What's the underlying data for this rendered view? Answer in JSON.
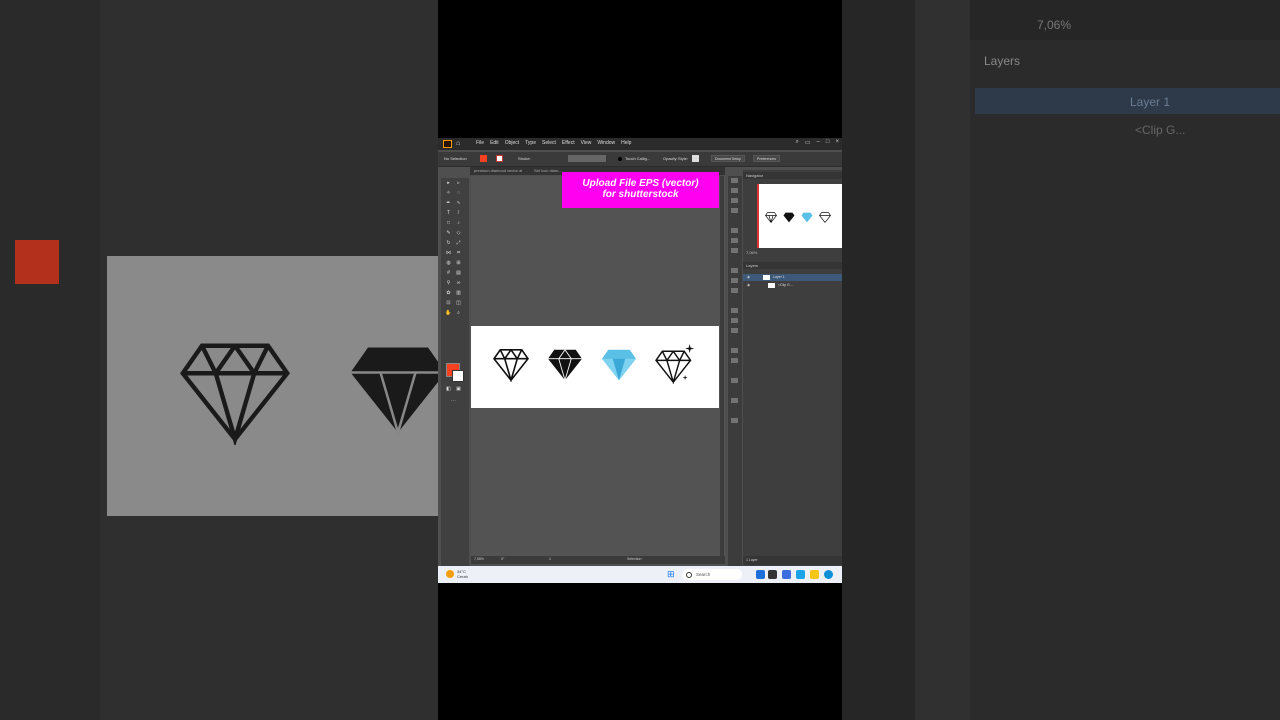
{
  "background": {
    "zoom_text": "7,06%",
    "panel_title": "Layers",
    "layer1_label": "Layer 1",
    "layer2_label": "<Clip G..."
  },
  "app": {
    "menu": [
      "File",
      "Edit",
      "Object",
      "Type",
      "Select",
      "Effect",
      "View",
      "Window",
      "Help"
    ],
    "control": {
      "selection_label": "No Selection",
      "stroke_label": "Stroke:",
      "brush_label": "Touch Callig...",
      "opacity_label": "Opacity:",
      "style_label": "Style:",
      "doc_setup": "Document Setup",
      "preferences": "Preferences"
    },
    "tabs": [
      "premium diamond vector ai",
      "Set icon diam..."
    ],
    "status": {
      "zoom": "7,06%",
      "rotate": "0°",
      "artboard_num": "1",
      "tool": "Selection"
    },
    "panels": {
      "navigator_title": "Navigator",
      "nav_zoom": "7,06%",
      "layers_title": "Layers",
      "layer1": "Layer 1",
      "layer2": "<Clip G...",
      "layers_count": "1 Layer"
    }
  },
  "banner": {
    "line1": "Upload File EPS (vector)",
    "line2": "for shutterstock"
  },
  "taskbar": {
    "temp": "34°C",
    "weather": "Cerah",
    "search_placeholder": "Search"
  },
  "colors": {
    "banner": "#ff00f0",
    "fill_swatch": "#f4411f",
    "diamond_blue": "#5bc0e6",
    "layer_select": "#3e5a7a"
  }
}
